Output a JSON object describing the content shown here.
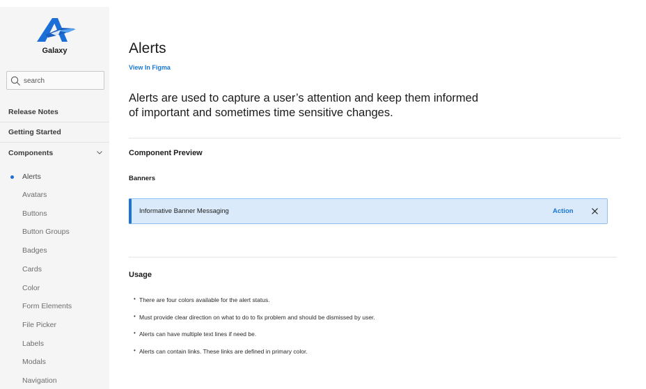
{
  "sidebar": {
    "brand_name": "Galaxy",
    "search_placeholder": "search",
    "sections": [
      {
        "label": "Release Notes"
      },
      {
        "label": "Getting Started"
      },
      {
        "label": "Components"
      }
    ],
    "components": [
      {
        "label": "Alerts",
        "active": true
      },
      {
        "label": "Avatars"
      },
      {
        "label": "Buttons"
      },
      {
        "label": "Button Groups"
      },
      {
        "label": "Badges"
      },
      {
        "label": "Cards"
      },
      {
        "label": "Color"
      },
      {
        "label": "Form Elements"
      },
      {
        "label": "File Picker"
      },
      {
        "label": "Labels"
      },
      {
        "label": "Modals"
      },
      {
        "label": "Navigation"
      }
    ]
  },
  "main": {
    "title": "Alerts",
    "figma_link": "View In Figma",
    "intro_line1": "Alerts are used to capture a user’s attention and keep them informed",
    "intro_line2": "of important and sometimes time sensitive changes.",
    "preview_title": "Component Preview",
    "banners_title": "Banners",
    "banner": {
      "message": "Informative Banner Messaging",
      "action": "Action"
    },
    "usage_title": "Usage",
    "usage_items": [
      "There are four colors available for the alert status.",
      "Must provide clear direction on what to do to fix problem and should be dismissed by user.",
      "Alerts can have multiple text lines if need be.",
      "Alerts can contain links. These links are defined in primary color."
    ]
  },
  "colors": {
    "accent": "#1677d6",
    "banner_bg": "#dbeafb",
    "banner_border": "#1c74d6",
    "sidebar_bg": "#f5f5f5"
  },
  "icons": [
    "galaxy-logo",
    "search-icon",
    "chevron-down-icon",
    "close-icon"
  ]
}
